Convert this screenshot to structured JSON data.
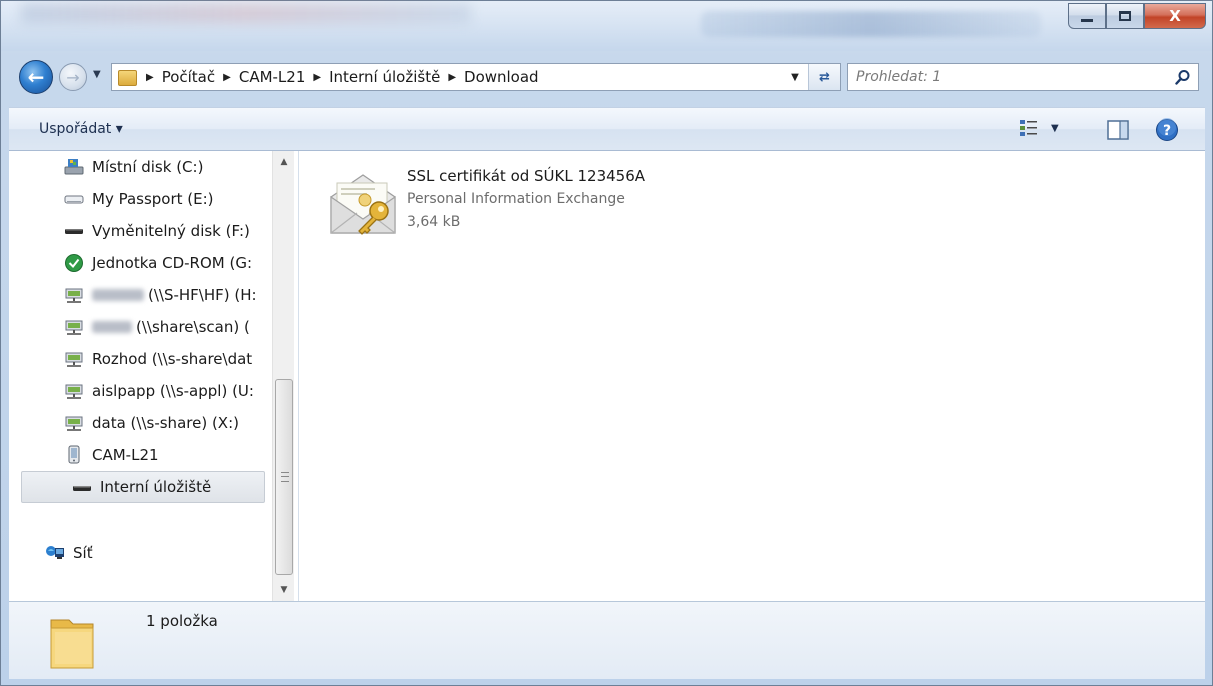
{
  "window": {
    "controls": {
      "minimize": "—",
      "maximize": "□",
      "close": "X"
    }
  },
  "nav": {
    "breadcrumbs": [
      "Počítač",
      "CAM-L21",
      "Interní úložiště",
      "Download"
    ],
    "search_placeholder": "Prohledat: 1"
  },
  "toolbar": {
    "organize_label": "Uspořádat ▾"
  },
  "sidebar": {
    "items": [
      {
        "label": "Místní disk (C:)",
        "icon": "local-disk-icon",
        "indent": 1,
        "blurred": false
      },
      {
        "label": "My Passport (E:)",
        "icon": "external-drive-icon",
        "indent": 1,
        "blurred": false
      },
      {
        "label": "Vyměnitelný disk (F:)",
        "icon": "removable-disk-icon",
        "indent": 1,
        "blurred": false
      },
      {
        "label": "Jednotka CD-ROM (G:",
        "icon": "cd-rom-icon",
        "indent": 1,
        "blurred": false
      },
      {
        "label": "(\\\\S-HF\\HF) (H:",
        "icon": "network-drive-icon",
        "indent": 1,
        "blurred": true
      },
      {
        "label": "(\\\\share\\scan) (",
        "icon": "network-drive-icon",
        "indent": 1,
        "blurred": true
      },
      {
        "label": "Rozhod (\\\\s-share\\dat",
        "icon": "network-drive-icon",
        "indent": 1,
        "blurred": false
      },
      {
        "label": "aislpapp (\\\\s-appl) (U:",
        "icon": "network-drive-icon",
        "indent": 1,
        "blurred": false
      },
      {
        "label": "data (\\\\s-share) (X:)",
        "icon": "network-drive-icon",
        "indent": 1,
        "blurred": false
      },
      {
        "label": "CAM-L21",
        "icon": "phone-device-icon",
        "indent": 1,
        "blurred": false
      },
      {
        "label": "Interní úložiště",
        "icon": "storage-drive-icon",
        "indent": 2,
        "blurred": false,
        "selected": true
      },
      {
        "label": "Síť",
        "icon": "network-icon",
        "indent": 0,
        "blurred": false
      }
    ]
  },
  "content": {
    "files": [
      {
        "name": "SSL certifikát od SÚKL 123456A",
        "type": "Personal Information Exchange",
        "size": "3,64 kB",
        "icon": "certificate-icon"
      }
    ]
  },
  "details": {
    "count_text": "1 položka"
  },
  "colors": {
    "frame": "#bcd1ea",
    "selection": "#dfe3e8",
    "close_button": "#c24428",
    "secondary_text": "#6d6d6d"
  }
}
